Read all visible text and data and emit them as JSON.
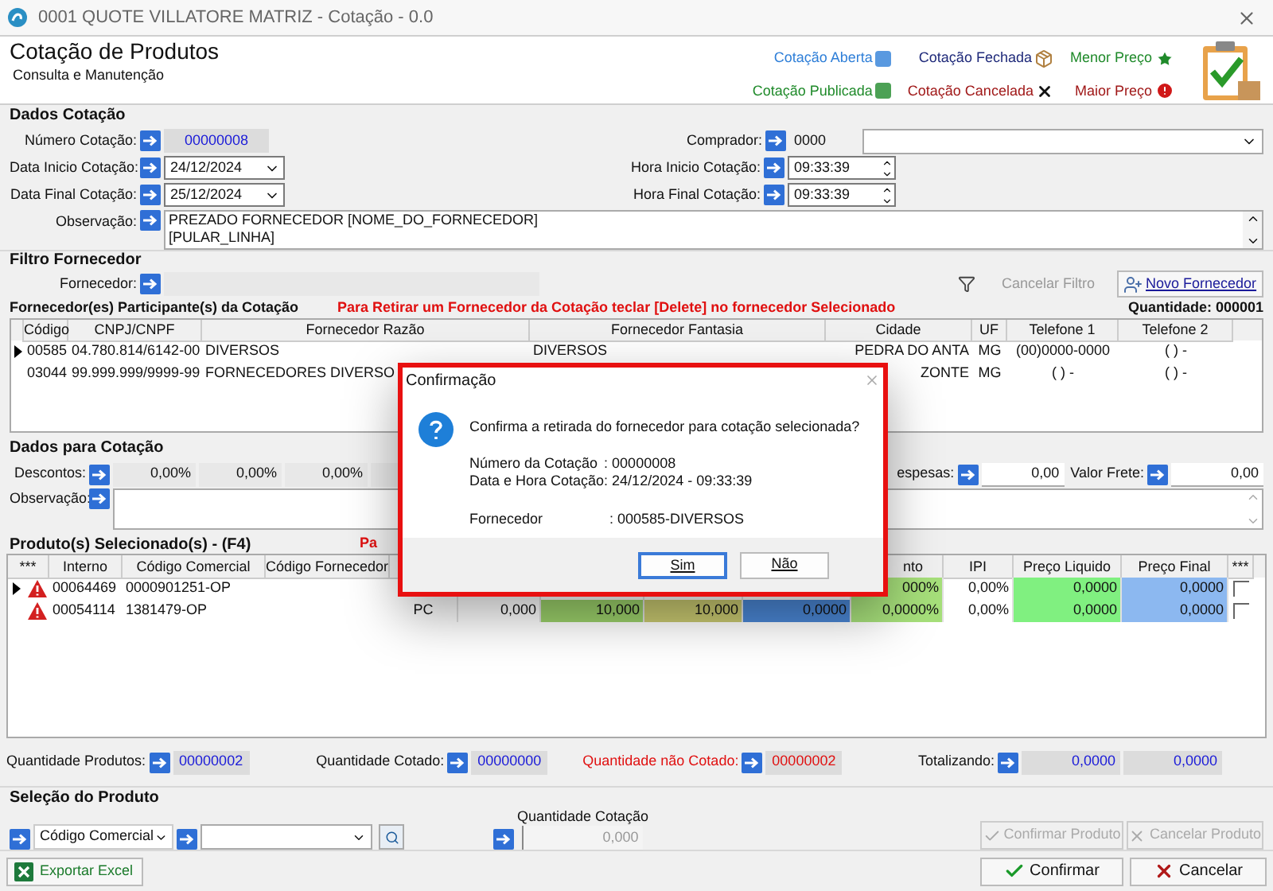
{
  "window": {
    "title": "0001 QUOTE VILLATORE MATRIZ - Cotação - 0.0"
  },
  "header": {
    "title": "Cotação de Produtos",
    "subtitle": "Consulta e Manutenção",
    "legend": [
      {
        "label": "Cotação Aberta",
        "color": "#2f7fd8",
        "kind": "square"
      },
      {
        "label": "Cotação Fechada",
        "color": "#1f2a7a",
        "kind": "package"
      },
      {
        "label": "Menor Preço",
        "color": "#1f8a2a",
        "kind": "star"
      },
      {
        "label": "Cotação Publicada",
        "color": "#1f8a2a",
        "kind": "square"
      },
      {
        "label": "Cotação Cancelada",
        "color": "#a01818",
        "kind": "cross"
      },
      {
        "label": "Maior Preço",
        "color": "#a01818",
        "kind": "alert"
      }
    ]
  },
  "dados_cotacao": {
    "title": "Dados Cotação",
    "numero": {
      "label": "Número Cotação:",
      "value": "00000008"
    },
    "comprador": {
      "label": "Comprador:",
      "code": "0000"
    },
    "data_inicio": {
      "label": "Data Inicio Cotação:",
      "value": "24/12/2024"
    },
    "hora_inicio": {
      "label": "Hora Inicio Cotação:",
      "value": "09:33:39"
    },
    "data_final": {
      "label": "Data Final Cotação:",
      "value": "25/12/2024"
    },
    "hora_final": {
      "label": "Hora Final Cotação:",
      "value": "09:33:39"
    },
    "observacao": {
      "label": "Observação:",
      "lines": [
        "PREZADO FORNECEDOR [NOME_DO_FORNECEDOR]",
        "[PULAR_LINHA]"
      ]
    }
  },
  "filtro": {
    "title": "Filtro Fornecedor",
    "label": "Fornecedor:",
    "cancel_button": {
      "label": "Cancelar Filtro",
      "disabled": true
    },
    "new_button": {
      "label": "Novo Fornecedor"
    }
  },
  "fornecedores": {
    "title": "Fornecedor(es) Participante(s) da Cotação",
    "hint": "Para Retirar um Fornecedor da Cotação teclar [Delete] no fornecedor Selecionado",
    "count": "Quantidade: 000001",
    "columns": [
      "Código",
      "CNPJ/CNPF",
      "Fornecedor Razão",
      "Fornecedor Fantasia",
      "Cidade",
      "UF",
      "Telefone 1",
      "Telefone 2"
    ],
    "rows": [
      {
        "selected": true,
        "cells": [
          "00585",
          "04.780.814/6142-00",
          "DIVERSOS",
          "DIVERSOS",
          "PEDRA DO ANTA",
          "MG",
          "(00)0000-0000",
          "(  )   -"
        ]
      },
      {
        "selected": false,
        "cells": [
          "03044",
          "99.999.999/9999-99",
          "FORNECEDORES DIVERSO",
          null,
          "ZONTE",
          "MG",
          "(  )   -",
          "(  )   -"
        ]
      }
    ]
  },
  "dados_para_cotacao": {
    "title": "Dados para Cotação",
    "descontos_label": "Descontos:",
    "descontos": [
      "0,00%",
      "0,00%",
      "0,00%"
    ],
    "despesas_label": "espesas:",
    "despesas": "0,00",
    "frete_label": "Valor Frete:",
    "frete": "0,00",
    "observacao_label": "Observação:"
  },
  "produtos": {
    "title": "Produto(s) Selecionado(s) - (F4)",
    "hint": "Pa",
    "columns_left": [
      "***",
      "Interno",
      "Código Comercial",
      "Código Fornecedor"
    ],
    "columns_right": [
      "nto",
      "IPI",
      "Preço Liquido",
      "Preço Final",
      "***"
    ],
    "rows": [
      {
        "selected": true,
        "warning": true,
        "interno": "00064469",
        "codigo": "0000901251-OP",
        "values": [
          "000%",
          "0,00%",
          "0,0000",
          "0,0000"
        ],
        "checked": false
      },
      {
        "selected": false,
        "warning": true,
        "interno": "00054114",
        "codigo": "1381479-OP",
        "values": [
          "PC",
          "0,000",
          "10,000",
          "10,000",
          "0,0000",
          "0,0000%",
          "0,00%",
          "0,0000",
          "0,0000"
        ],
        "checked": false
      }
    ]
  },
  "totals": {
    "quantidade_produtos": {
      "label": "Quantidade Produtos:",
      "value": "00000002"
    },
    "quantidade_cotado": {
      "label": "Quantidade Cotado:",
      "value": "00000000"
    },
    "quantidade_nao_cotado": {
      "label": "Quantidade não Cotado:",
      "value": "00000002"
    },
    "totalizando": {
      "label": "Totalizando:",
      "values": [
        "0,0000",
        "0,0000"
      ]
    }
  },
  "selecao": {
    "title": "Seleção do Produto",
    "search_by": "Código Comercial",
    "quantity_label": "Quantidade Cotação",
    "quantity": "0,000",
    "confirm_button": {
      "label": "Confirmar Produto",
      "disabled": true
    },
    "cancel_button": {
      "label": "Cancelar Produto",
      "disabled": true
    }
  },
  "footer": {
    "export": "Exportar Excel",
    "confirm": "Confirmar",
    "cancel": "Cancelar"
  },
  "dialog": {
    "title": "Confirmação",
    "message": "Confirma a retirada do fornecedor para cotação selecionada?",
    "details": [
      {
        "label": "Número da Cotação",
        "value": ": 00000008"
      },
      {
        "label": "Data e Hora Cotação",
        "value": ": 24/12/2024 - 09:33:39"
      }
    ],
    "fornecedor": {
      "label": "Fornecedor",
      "value": ": 000585-DIVERSOS"
    },
    "buttons": [
      {
        "label": "Sim",
        "selected": true
      },
      {
        "label": "Não",
        "selected": false
      }
    ]
  }
}
